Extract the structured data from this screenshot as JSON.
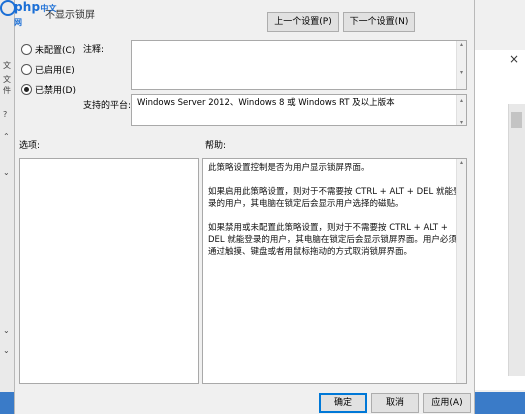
{
  "logo": {
    "text": "php",
    "text_small": "中文网"
  },
  "dialog": {
    "title_fragment": "不显示锁屏",
    "nav": {
      "prev_label": "上一个设置(P)",
      "next_label": "下一个设置(N)"
    },
    "radio_options": [
      {
        "label": "未配置(C)",
        "checked": false
      },
      {
        "label": "已启用(E)",
        "checked": false
      },
      {
        "label": "已禁用(D)",
        "checked": true
      }
    ],
    "comment_label": "注释:",
    "comment_value": "",
    "supported_label": "支持的平台:",
    "supported_value": "Windows Server 2012、Windows 8 或 Windows RT 及以上版本",
    "options_label": "选项:",
    "help_label": "帮助:",
    "help_paragraphs": [
      "此策略设置控制是否为用户显示锁屏界面。",
      "如果启用此策略设置，则对于不需要按 CTRL + ALT + DEL 就能登录的用户，其电脑在锁定后会显示用户选择的磁贴。",
      "如果禁用或未配置此策略设置，则对于不需要按 CTRL + ALT + DEL 就能登录的用户，其电脑在锁定后会显示锁屏界面。用户必须通过触摸、键盘或者用鼠标拖动的方式取消锁屏界面。"
    ],
    "buttons": {
      "ok": "确定",
      "cancel": "取消",
      "apply": "应用(A)"
    }
  },
  "background": {
    "left_fragments": [
      "文",
      "文件",
      "?",
      "⌃",
      "⌄",
      "⌄",
      "⌄"
    ],
    "right_close": "×"
  }
}
